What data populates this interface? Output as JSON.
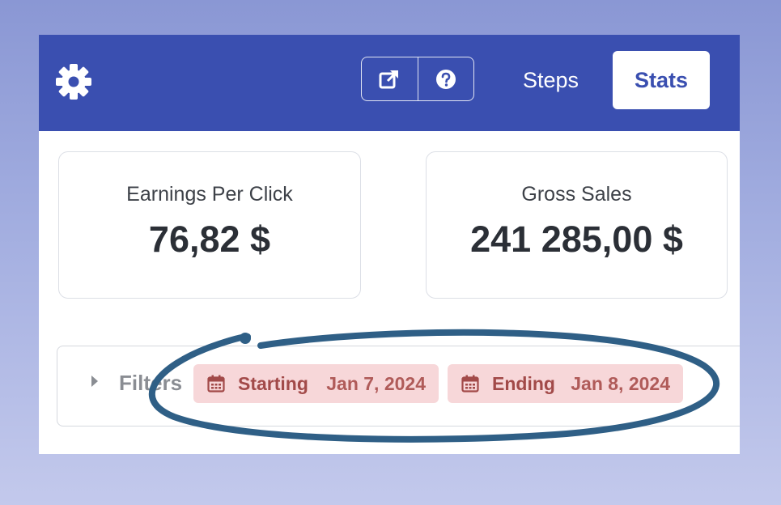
{
  "toolbar": {
    "settings_icon": "gear-icon",
    "external_link_icon": "external-link-icon",
    "help_icon": "question-circle-icon",
    "steps_label": "Steps",
    "stats_label": "Stats",
    "bar_color": "#3a4fb0"
  },
  "metrics": [
    {
      "label": "Earnings Per Click",
      "value": "76,82 $"
    },
    {
      "label": "Gross Sales",
      "value": "241 285,00 $"
    }
  ],
  "filters": {
    "label": "Filters",
    "starting": {
      "label": "Starting",
      "date": "Jan 7, 2024",
      "icon": "calendar-icon"
    },
    "ending": {
      "label": "Ending",
      "date": "Jan 8, 2024",
      "icon": "calendar-icon"
    },
    "pill_color": "#f7d7d9",
    "pill_text_color": "#a24a49"
  },
  "annotation": {
    "shape": "hand-drawn-ellipse",
    "color": "#2f5f86"
  }
}
